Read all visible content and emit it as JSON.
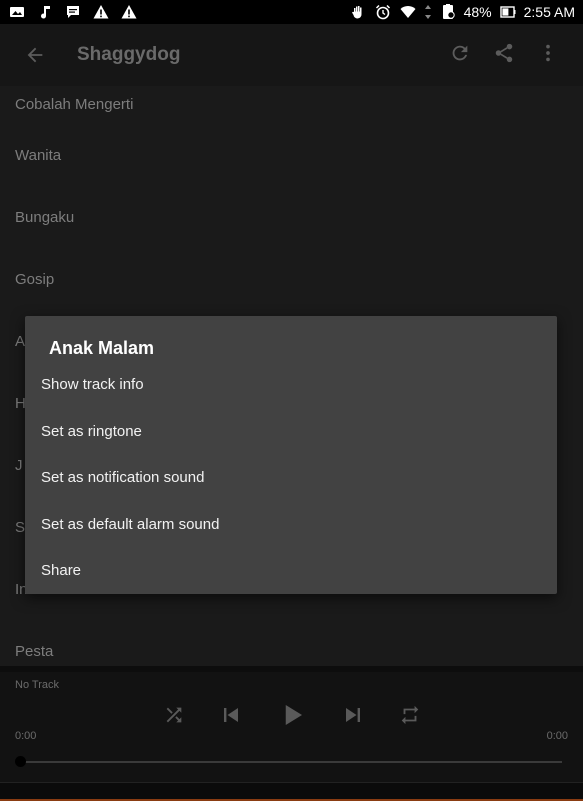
{
  "status_bar": {
    "battery": "48%",
    "time": "2:55 AM",
    "left_icons": [
      "gallery-icon",
      "music-note-icon",
      "chat-icon",
      "warning-icon",
      "warning-icon"
    ],
    "right_icons": [
      "hand-icon",
      "alarm-icon",
      "wifi-icon",
      "data-arrows-icon",
      "battery-saver-icon",
      "battery-icon"
    ]
  },
  "app_bar": {
    "title": "Shaggydog",
    "icons": [
      "back-arrow-icon",
      "refresh-icon",
      "share-icon",
      "more-vert-icon"
    ]
  },
  "tracks": [
    "Cobalah Mengerti",
    "Wanita",
    "Bungaku",
    "Gosip",
    "A",
    "H",
    "J",
    "S",
    "Insomnia",
    "Pesta"
  ],
  "dialog": {
    "title": "Anak Malam",
    "items": [
      "Show track info",
      "Set as ringtone",
      "Set as notification sound",
      "Set as default alarm sound",
      "Share"
    ]
  },
  "player": {
    "track_label": "No Track",
    "time_elapsed": "0:00",
    "time_total": "0:00",
    "progress": 0,
    "icons": [
      "shuffle-icon",
      "previous-icon",
      "play-icon",
      "next-icon",
      "repeat-icon"
    ]
  }
}
